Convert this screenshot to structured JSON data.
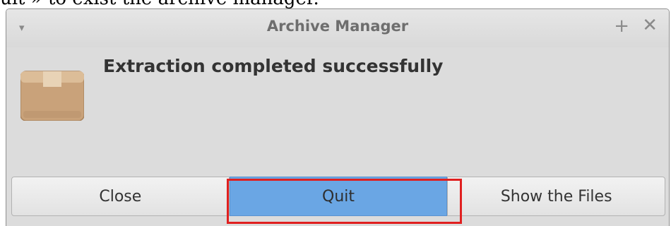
{
  "caption": {
    "text": "uit » to exist the archive manager."
  },
  "window": {
    "title": "Archive Manager",
    "menu_glyph": "▾",
    "maximize_glyph": "+",
    "close_glyph": "✕"
  },
  "dialog": {
    "icon": "package-box-icon",
    "message": "Extraction completed successfully"
  },
  "buttons": {
    "close_label": "Close",
    "quit_label": "Quit",
    "show_files_label": "Show the Files"
  },
  "colors": {
    "quit_button": "#6aa6e4",
    "highlight_outline": "#e02020",
    "window_background": "#dcdcdc"
  }
}
